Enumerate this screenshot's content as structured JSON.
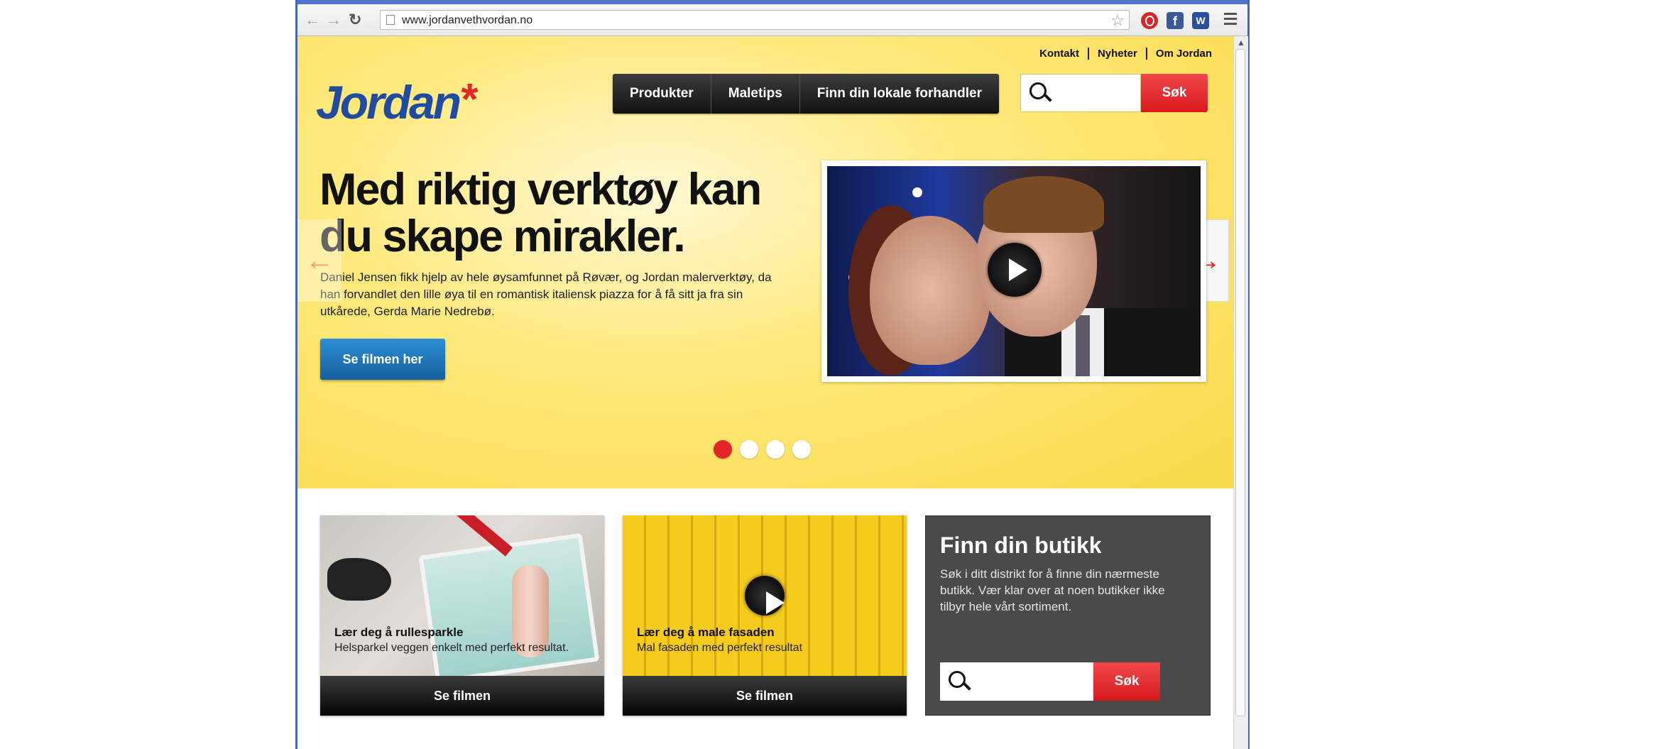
{
  "browser": {
    "url": "www.jordanvethvordan.no"
  },
  "header": {
    "top_links": [
      "Kontakt",
      "Nyheter",
      "Om Jordan"
    ],
    "logo": "Jordan",
    "nav": [
      "Produkter",
      "Maletips",
      "Finn din lokale forhandler"
    ],
    "search_button": "Søk"
  },
  "hero": {
    "headline": "Med riktig verktøy kan du skape mirakler.",
    "lead": "Daniel Jensen fikk hjelp av hele øysamfunnet på Røvær, og Jordan malerverktøy, da han forvandlet den lille øya til en romantisk italiensk piazza for å få sitt ja fra sin utkårede, Gerda Marie Nedrebø.",
    "cta": "Se filmen her",
    "slide_count": 4,
    "active_slide": 1
  },
  "cards": [
    {
      "title": "Lær deg å rullesparkle",
      "subtitle": "Helsparkel veggen enkelt med perfekt resultat.",
      "button": "Se filmen"
    },
    {
      "title": "Lær deg å male fasaden",
      "subtitle": "Mal fasaden med perfekt resultat",
      "button": "Se filmen"
    }
  ],
  "store_finder": {
    "heading": "Finn din butikk",
    "description": "Søk i ditt distrikt for å finne din nærmeste butikk. Vær klar over at noen butikker ikke tilbyr hele vårt sortiment.",
    "search_button": "Søk"
  },
  "colors": {
    "accent_red": "#e4262a",
    "brand_blue": "#1f4ba0",
    "cta_blue": "#1b75bb",
    "hero_yellow": "#f9d949"
  }
}
